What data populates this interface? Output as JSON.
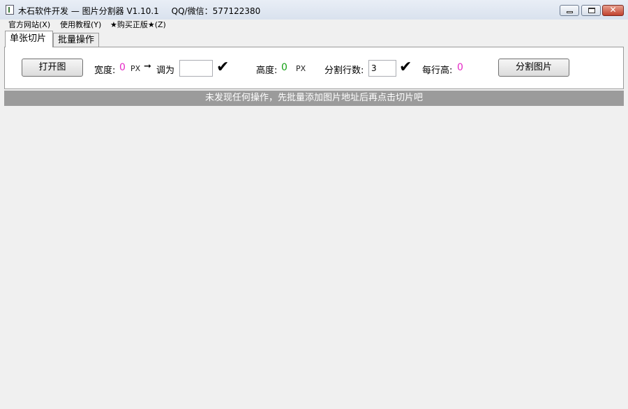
{
  "titlebar": {
    "app_name": "木石软件开发 — 图片分割器 V1.10.1",
    "contact": "QQ/微信：577122380"
  },
  "menu": [
    {
      "label": "官方网站(X)"
    },
    {
      "label": "使用教程(Y)"
    },
    {
      "label": "★购买正版★(Z)"
    }
  ],
  "tabs": [
    {
      "label": "单张切片",
      "active": true
    },
    {
      "label": "批量操作",
      "active": false
    }
  ],
  "toolbar": {
    "open_button": "打开图",
    "width_label": "宽度:",
    "width_value": "0",
    "px_unit": "PX",
    "arrow": "➞",
    "adjust_label": "调为",
    "adjust_value": "",
    "height_label": "高度:",
    "height_value": "0",
    "height_unit": "PX",
    "rows_label": "分割行数:",
    "rows_value": "3",
    "row_height_label": "每行高:",
    "row_height_value": "0",
    "split_button": "分割图片",
    "check_icon": "✔"
  },
  "status": {
    "message": "未发现任何操作，先批量添加图片地址后再点击切片吧"
  },
  "colors": {
    "pink_value": "#e528c6",
    "green_value": "#15a015",
    "status_bg": "#9b9b9b"
  }
}
